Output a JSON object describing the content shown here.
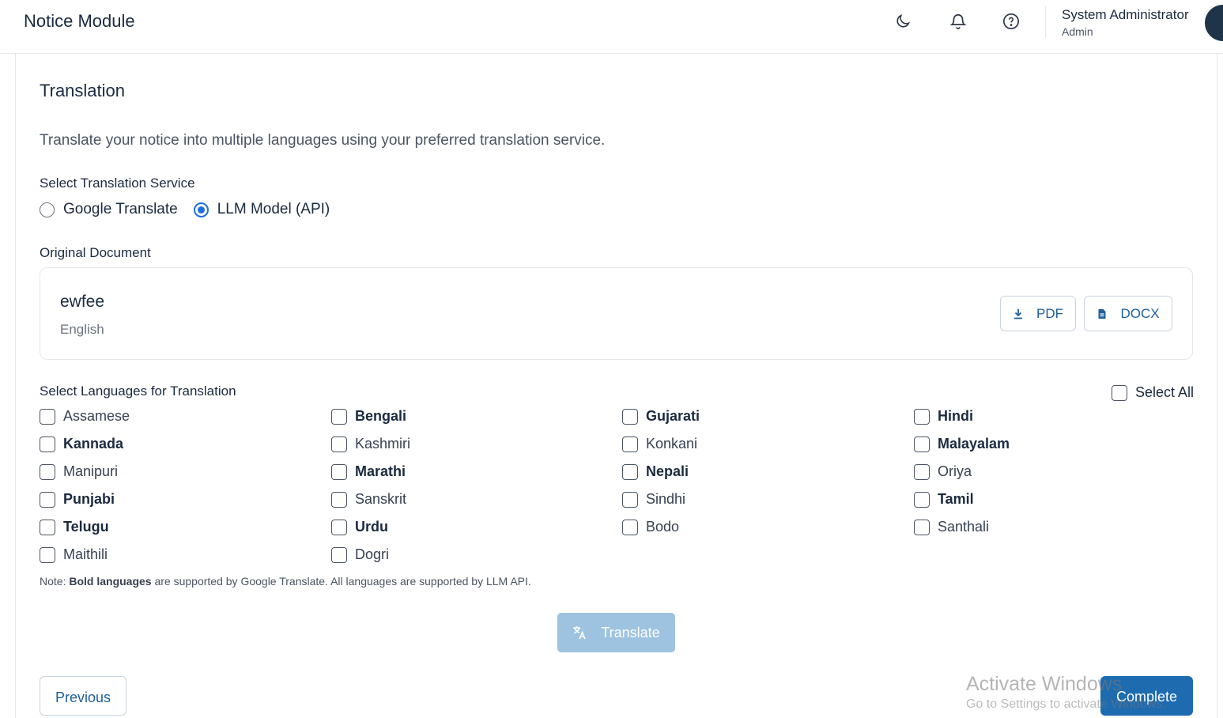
{
  "header": {
    "title": "Notice Module",
    "user_name": "System Administrator",
    "user_role": "Admin"
  },
  "translation": {
    "title": "Translation",
    "description": "Translate your notice into multiple languages using your preferred translation service.",
    "service_label": "Select Translation Service",
    "services": [
      {
        "label": "Google Translate",
        "selected": false
      },
      {
        "label": "LLM Model (API)",
        "selected": true
      }
    ],
    "original_label": "Original Document",
    "document": {
      "name": "ewfee",
      "language": "English",
      "pdf_label": "PDF",
      "docx_label": "DOCX"
    },
    "languages_label": "Select Languages for Translation",
    "select_all_label": "Select All",
    "languages": [
      {
        "label": "Assamese",
        "bold": false
      },
      {
        "label": "Bengali",
        "bold": true
      },
      {
        "label": "Gujarati",
        "bold": true
      },
      {
        "label": "Hindi",
        "bold": true
      },
      {
        "label": "Kannada",
        "bold": true
      },
      {
        "label": "Kashmiri",
        "bold": false
      },
      {
        "label": "Konkani",
        "bold": false
      },
      {
        "label": "Malayalam",
        "bold": true
      },
      {
        "label": "Manipuri",
        "bold": false
      },
      {
        "label": "Marathi",
        "bold": true
      },
      {
        "label": "Nepali",
        "bold": true
      },
      {
        "label": "Oriya",
        "bold": false
      },
      {
        "label": "Punjabi",
        "bold": true
      },
      {
        "label": "Sanskrit",
        "bold": false
      },
      {
        "label": "Sindhi",
        "bold": false
      },
      {
        "label": "Tamil",
        "bold": true
      },
      {
        "label": "Telugu",
        "bold": true
      },
      {
        "label": "Urdu",
        "bold": true
      },
      {
        "label": "Bodo",
        "bold": false
      },
      {
        "label": "Santhali",
        "bold": false
      },
      {
        "label": "Maithili",
        "bold": false
      },
      {
        "label": "Dogri",
        "bold": false
      }
    ],
    "note_prefix": "Note: ",
    "note_bold": "Bold languages",
    "note_suffix": " are supported by Google Translate. All languages are supported by LLM API.",
    "translate_label": "Translate"
  },
  "footer": {
    "previous_label": "Previous",
    "complete_label": "Complete"
  },
  "watermark": {
    "line1": "Activate Windows",
    "line2": "Go to Settings to activate Windows."
  },
  "icons": {
    "theme": "moon-icon",
    "notifications": "bell-icon",
    "help": "help-circle-icon",
    "pdf": "download-icon",
    "docx": "document-icon",
    "translate": "translate-icon"
  },
  "colors": {
    "primary": "#1e6bb0",
    "primary_disabled": "#9dc3e0",
    "radio_selected": "#1d6fe0",
    "text_dark": "#1b2a3f"
  }
}
